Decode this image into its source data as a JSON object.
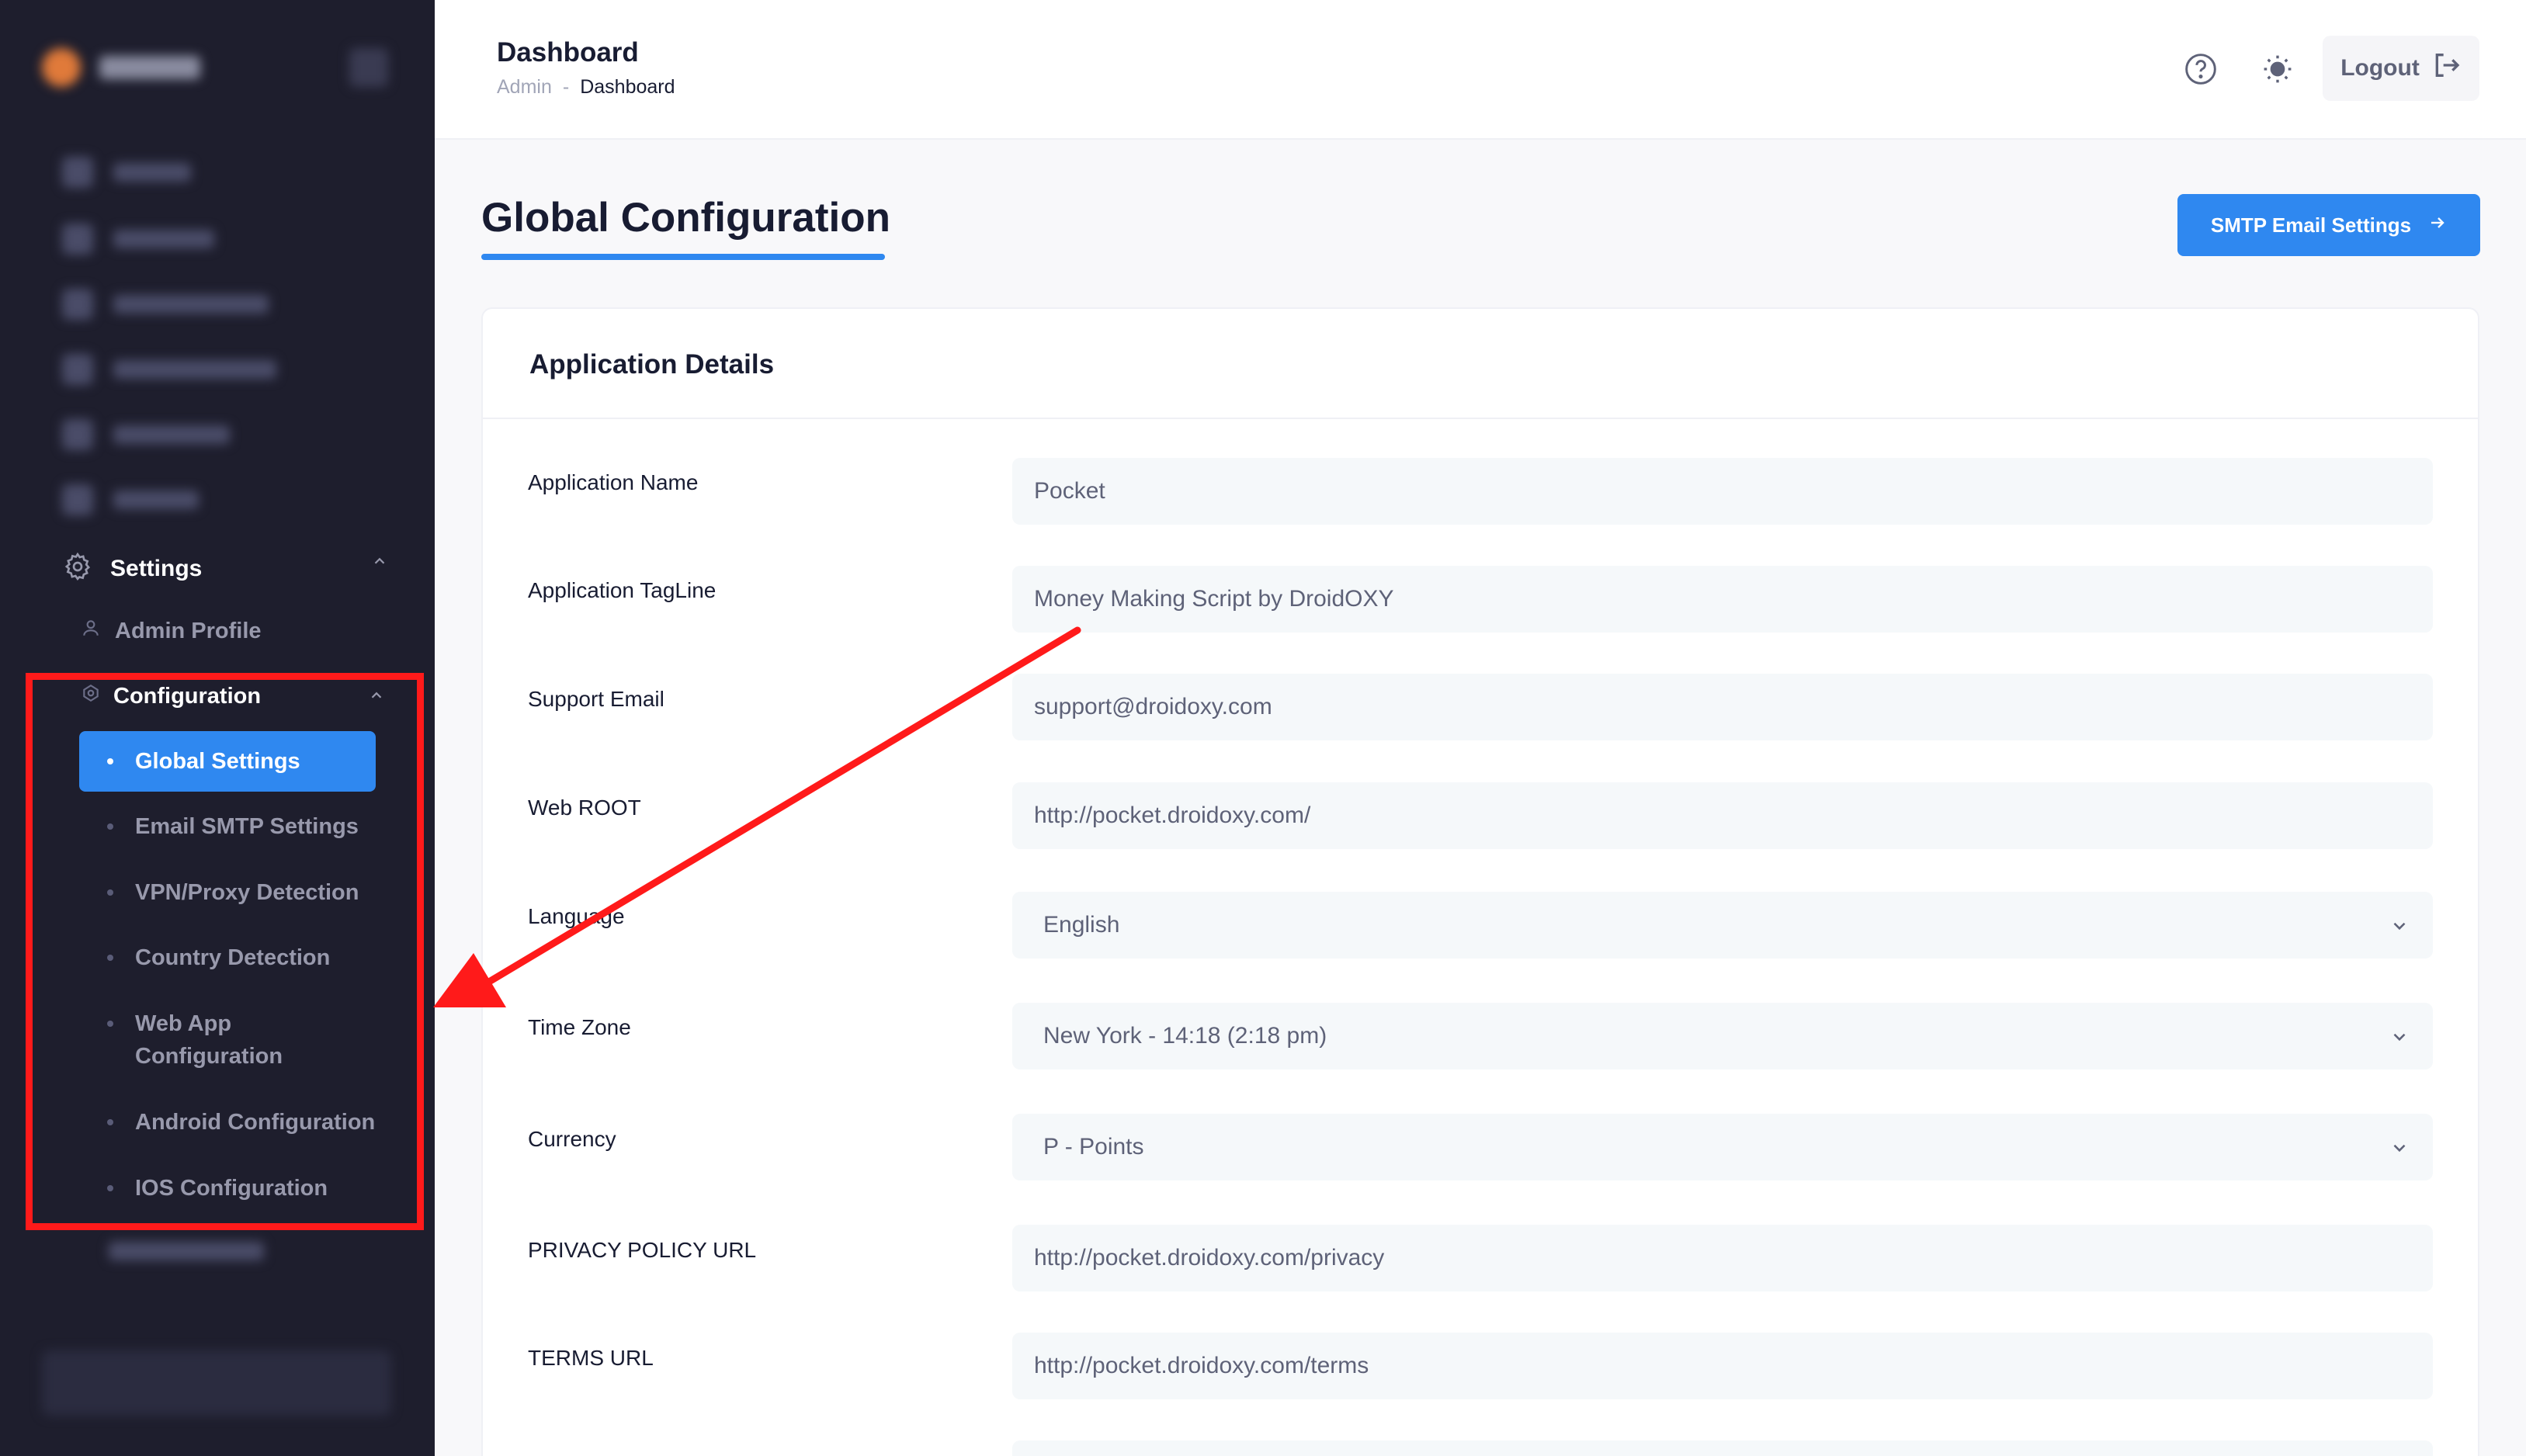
{
  "header": {
    "title": "Dashboard",
    "breadcrumb": [
      "Admin",
      "Dashboard"
    ],
    "breadcrumb_sep": "-",
    "logout_label": "Logout"
  },
  "sidebar": {
    "settings_label": "Settings",
    "admin_profile_label": "Admin Profile",
    "configuration_label": "Configuration",
    "config_items": [
      {
        "label": "Global Settings",
        "active": true
      },
      {
        "label": "Email SMTP Settings",
        "active": false
      },
      {
        "label": "VPN/Proxy Detection",
        "active": false
      },
      {
        "label": "Country Detection",
        "active": false
      },
      {
        "label": "Web App Configuration",
        "active": false
      },
      {
        "label": "Android Configuration",
        "active": false
      },
      {
        "label": "IOS Configuration",
        "active": false
      }
    ]
  },
  "page": {
    "title": "Global Configuration",
    "smtp_button": "SMTP Email Settings"
  },
  "card": {
    "title": "Application Details",
    "fields": [
      {
        "label": "Application Name",
        "value": "Pocket",
        "type": "input"
      },
      {
        "label": "Application TagLine",
        "value": "Money Making Script by DroidOXY",
        "type": "input"
      },
      {
        "label": "Support Email",
        "value": "support@droidoxy.com",
        "type": "input"
      },
      {
        "label": "Web ROOT",
        "value": "http://pocket.droidoxy.com/",
        "type": "input"
      },
      {
        "label": "Language",
        "value": "English",
        "type": "select"
      },
      {
        "label": "Time Zone",
        "value": "New York - 14:18 (2:18 pm)",
        "type": "select"
      },
      {
        "label": "Currency",
        "value": "P - Points",
        "type": "select"
      },
      {
        "label": "PRIVACY POLICY URL",
        "value": "http://pocket.droidoxy.com/privacy",
        "type": "input"
      },
      {
        "label": "TERMS URL",
        "value": "http://pocket.droidoxy.com/terms",
        "type": "input"
      }
    ]
  },
  "colors": {
    "sidebar_bg": "#1e1e2d",
    "accent": "#2f88f0",
    "annotation_red": "#ff1a1a"
  },
  "icons": [
    "help-icon",
    "theme-toggle-icon",
    "logout-icon",
    "gear-icon",
    "user-icon",
    "config-icon",
    "chevron-up-icon",
    "chevron-down-icon",
    "arrow-right-icon"
  ]
}
